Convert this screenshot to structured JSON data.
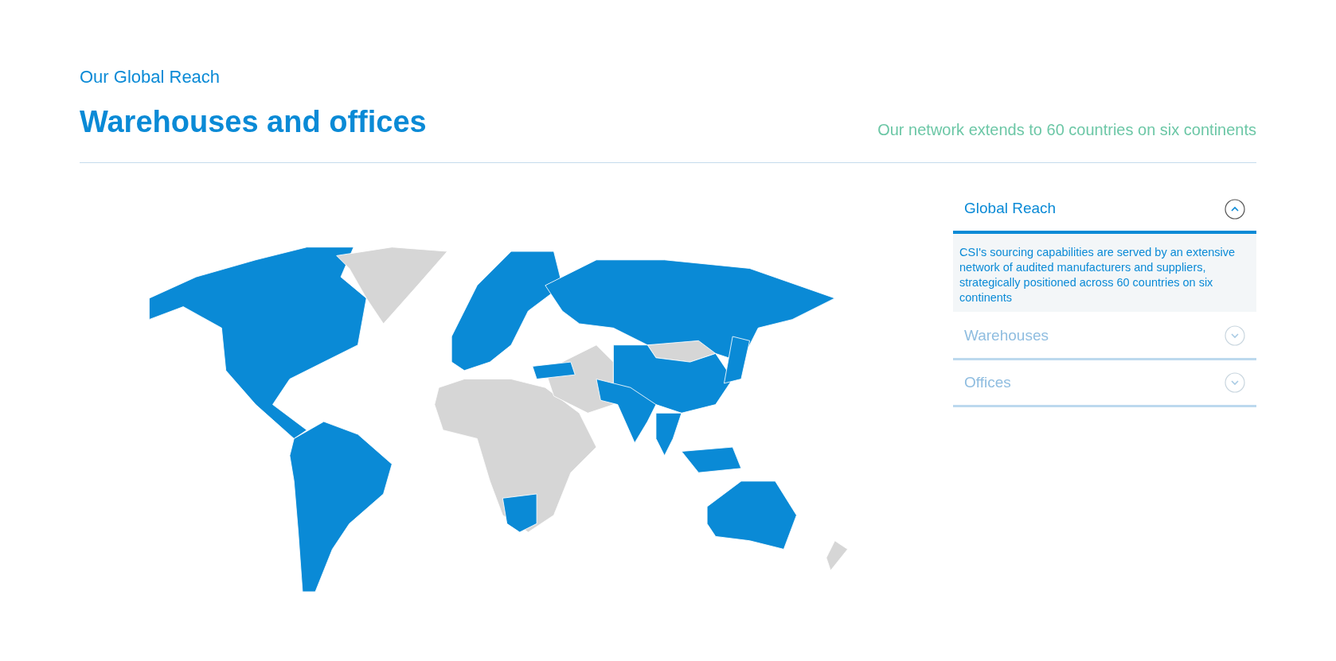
{
  "header": {
    "eyebrow": "Our Global Reach",
    "title": "Warehouses and offices",
    "tagline": "Our network extends to 60 countries on six continents"
  },
  "accordion": [
    {
      "title": "Global Reach",
      "expanded": true,
      "body": "CSI's sourcing capabilities are served by an extensive network of audited manufacturers and suppliers, strategically positioned across 60 countries on six continents"
    },
    {
      "title": "Warehouses",
      "expanded": false
    },
    {
      "title": "Offices",
      "expanded": false
    }
  ]
}
